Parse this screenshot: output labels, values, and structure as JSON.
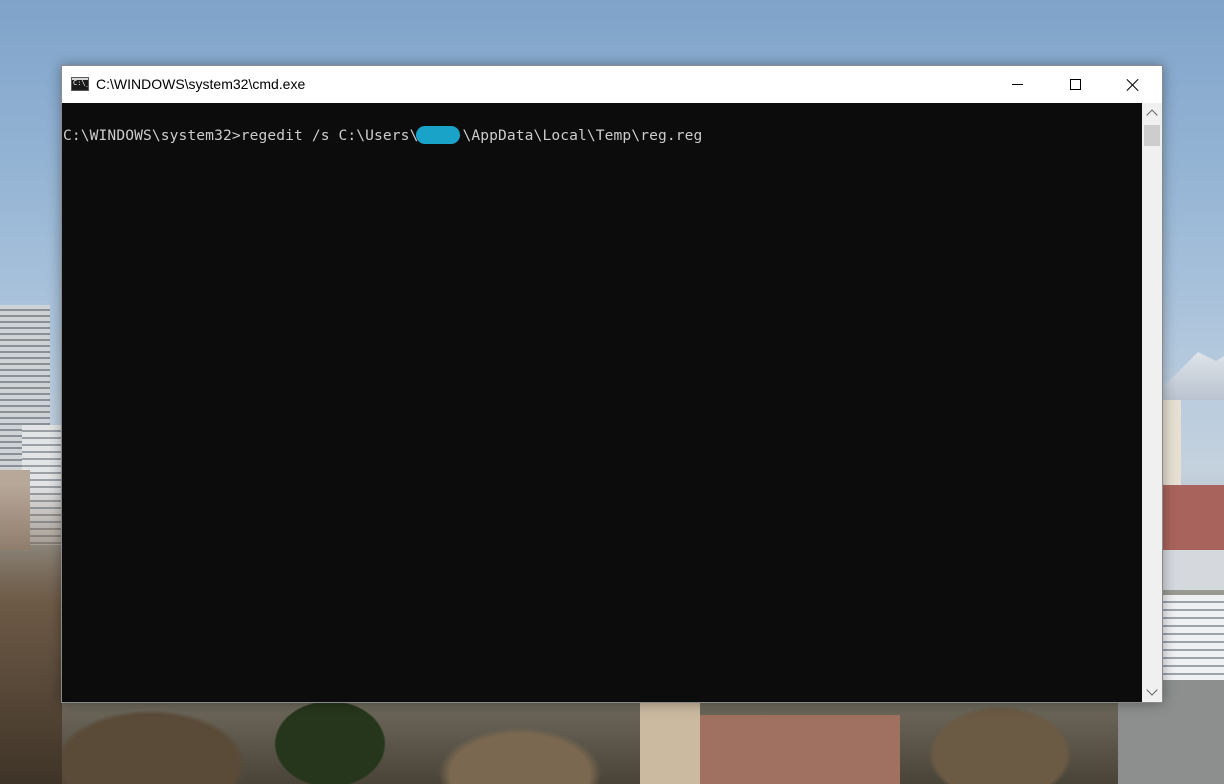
{
  "window": {
    "title": "C:\\WINDOWS\\system32\\cmd.exe",
    "icon": "cmd-icon",
    "icon_text": "C:\\_"
  },
  "caption_buttons": {
    "minimize": "minimize-icon",
    "maximize": "maximize-icon",
    "close": "close-icon"
  },
  "console": {
    "prompt": "C:\\WINDOWS\\system32>",
    "command_before_redaction": "regedit /s C:\\Users\\",
    "command_after_redaction": "\\AppData\\Local\\Temp\\reg.reg",
    "text_color": "#cccccc",
    "background_color": "#0c0c0c",
    "redaction_color": "#1aa3c8"
  },
  "scrollbar": {
    "up_icon": "chevron-up-icon",
    "down_icon": "chevron-down-icon"
  }
}
